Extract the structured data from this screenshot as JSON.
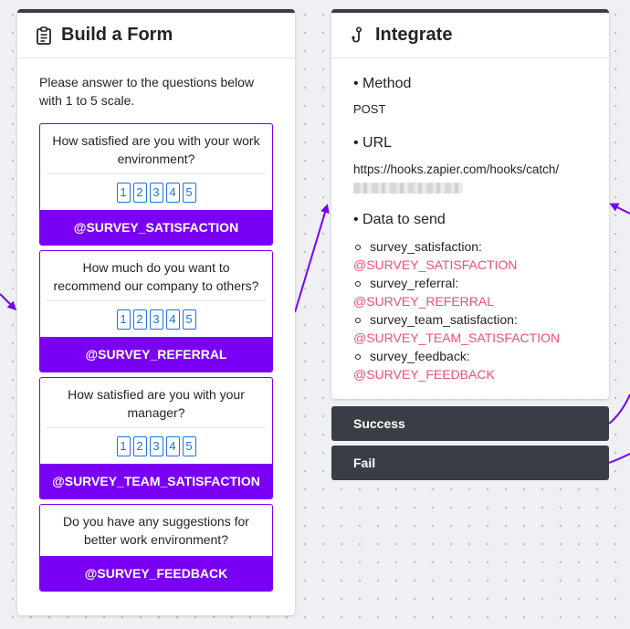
{
  "form": {
    "title": "Build a Form",
    "intro": "Please answer to the questions below with 1 to 5 scale.",
    "questions": [
      {
        "text": "How satisfied are you with your work environment?",
        "scale": [
          "1",
          "2",
          "3",
          "4",
          "5"
        ],
        "variable": "@SURVEY_SATISFACTION"
      },
      {
        "text": "How much do you want to recommend our company to others?",
        "scale": [
          "1",
          "2",
          "3",
          "4",
          "5"
        ],
        "variable": "@SURVEY_REFERRAL"
      },
      {
        "text": "How satisfied are you with your manager?",
        "scale": [
          "1",
          "2",
          "3",
          "4",
          "5"
        ],
        "variable": "@SURVEY_TEAM_SATISFACTION"
      },
      {
        "text": "Do you have any suggestions for better work environment?",
        "variable": "@SURVEY_FEEDBACK"
      }
    ]
  },
  "integrate": {
    "title": "Integrate",
    "method_label": "• Method",
    "method_value": "POST",
    "url_label": "• URL",
    "url_value": "https://hooks.zapier.com/hooks/catch/",
    "data_label": "• Data to send",
    "data_items": [
      {
        "key": "survey_satisfaction:",
        "value": "@SURVEY_SATISFACTION"
      },
      {
        "key": "survey_referral:",
        "value": "@SURVEY_REFERRAL"
      },
      {
        "key": "survey_team_satisfaction:",
        "value": "@SURVEY_TEAM_SATISFACTION"
      },
      {
        "key": "survey_feedback:",
        "value": "@SURVEY_FEEDBACK"
      }
    ]
  },
  "outcomes": {
    "success_label": "Success",
    "fail_label": "Fail"
  },
  "colors": {
    "accent": "#7a00f5",
    "dark": "#3a3d44",
    "variable_text": "#f0506e",
    "scale_blue": "#1a73e8"
  },
  "icons": {
    "form": "clipboard-icon",
    "integrate": "hook-icon"
  }
}
